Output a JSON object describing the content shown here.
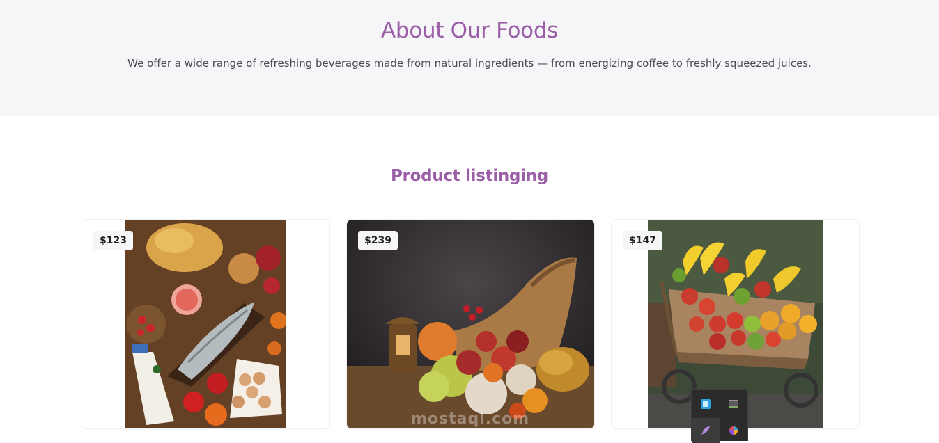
{
  "about": {
    "title": "About Our Foods",
    "description": "We offer a wide range of refreshing beverages made from natural ingredients — from energizing coffee to freshly squeezed juices."
  },
  "listing": {
    "title": "Product listinging"
  },
  "products": [
    {
      "price": "$123",
      "image": "groceries-flatlay-photo"
    },
    {
      "price": "$239",
      "image": "cornucopia-harvest-photo"
    },
    {
      "price": "$147",
      "image": "fruit-cart-photo"
    }
  ],
  "watermark": "mostaql.com",
  "colors": {
    "accent": "#9b5fa8",
    "section_bg": "#f6f6f9",
    "body_text": "#4b4b55"
  },
  "tray_icons": [
    "app-icon",
    "monitor-icon",
    "feather-icon",
    "copilot-icon"
  ]
}
